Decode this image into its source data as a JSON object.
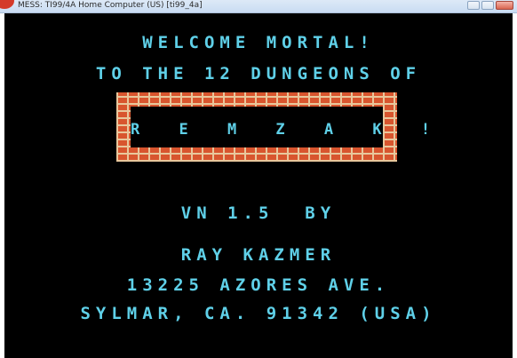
{
  "window": {
    "title": "MESS: TI99/4A Home Computer (US) [ti99_4a]"
  },
  "screen": {
    "welcome_line": "WELCOME MORTAL!",
    "dungeons_line": "TO THE 12 DUNGEONS OF",
    "game_title": "R E M Z A K !",
    "version_line": "VN 1.5  BY",
    "author_line": "RAY KAZMER",
    "address_line1": "13225 AZORES AVE.",
    "address_line2": "SYLMAR, CA. 91342 (USA)"
  },
  "colors": {
    "text": "#5fd0e8",
    "background": "#000000",
    "brick": "#d8552e",
    "mortar": "#e8c79c"
  }
}
